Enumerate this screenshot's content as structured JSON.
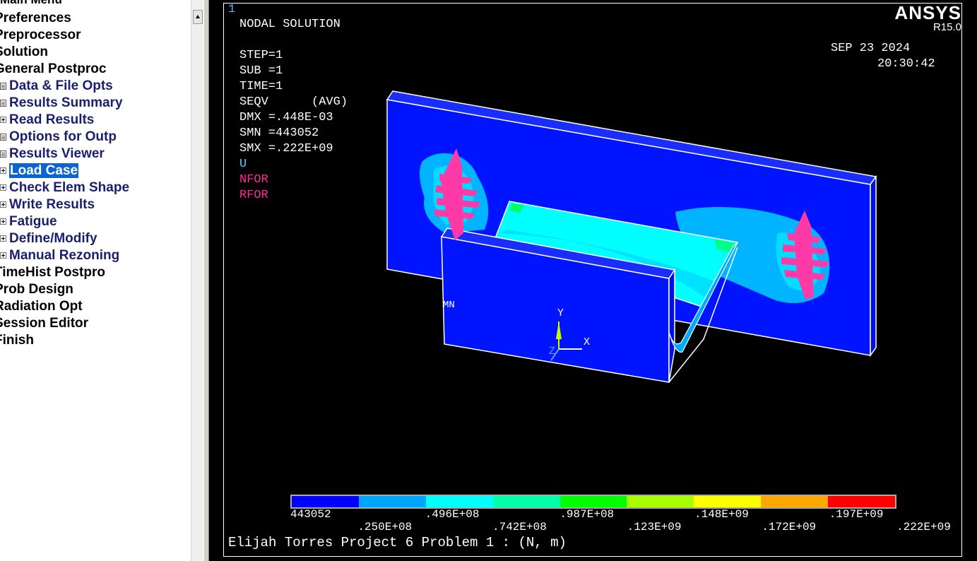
{
  "tree": {
    "title": "Main Menu",
    "items": [
      {
        "label": "Preferences",
        "level": 0
      },
      {
        "label": "Preprocessor",
        "level": 0
      },
      {
        "label": "Solution",
        "level": 0
      },
      {
        "label": "General Postproc",
        "level": 0
      },
      {
        "label": "Data & File Opts",
        "level": 1,
        "icon": "doc-icon"
      },
      {
        "label": "Results Summary",
        "level": 1,
        "icon": "doc-icon"
      },
      {
        "label": "Read Results",
        "level": 1,
        "icon": "expand-icon"
      },
      {
        "label": "Options for Outp",
        "level": 1,
        "icon": "doc-icon"
      },
      {
        "label": "Results Viewer",
        "level": 1,
        "icon": "doc-icon"
      },
      {
        "label": "Load Case",
        "level": 1,
        "icon": "expand-icon",
        "selected": true
      },
      {
        "label": "Check Elem Shape",
        "level": 1,
        "icon": "expand-icon"
      },
      {
        "label": "Write Results",
        "level": 1,
        "icon": "expand-icon"
      },
      {
        "label": "Fatigue",
        "level": 1,
        "icon": "expand-icon"
      },
      {
        "label": "Define/Modify",
        "level": 1,
        "icon": "expand-icon"
      },
      {
        "label": "Manual Rezoning",
        "level": 1,
        "icon": "expand-icon"
      },
      {
        "label": "TimeHist Postpro",
        "level": 0
      },
      {
        "label": "Prob Design",
        "level": 0
      },
      {
        "label": "Radiation Opt",
        "level": 0
      },
      {
        "label": "Session Editor",
        "level": 0
      },
      {
        "label": "Finish",
        "level": 0
      }
    ]
  },
  "graphics": {
    "window_number": "1",
    "brand": "ANSYS",
    "version": "R15.0",
    "info_lines": [
      "NODAL SOLUTION",
      "",
      "STEP=1",
      "SUB =1",
      "TIME=1",
      "SEQV      (AVG)",
      "DMX =.448E-03",
      "SMN =443052",
      "SMX =.222E+09"
    ],
    "date": "SEP 23 2024",
    "time": "20:30:42",
    "legend": {
      "u": "U",
      "nfor": "NFOR",
      "rfor": "RFOR"
    },
    "mn_label": "MN",
    "axis_labels": {
      "x": "X",
      "y": "Y",
      "z": "Z"
    },
    "contour_colors": [
      "#0000ff",
      "#00a6ff",
      "#00ffff",
      "#00ffa6",
      "#00ff00",
      "#a6ff00",
      "#ffff00",
      "#ffa600",
      "#ff0000"
    ],
    "contour_labels_top": [
      "443052",
      ".496E+08",
      ".987E+08",
      ".148E+09",
      ".197E+09"
    ],
    "contour_labels_bottom": [
      ".250E+08",
      ".742E+08",
      ".123E+09",
      ".172E+09",
      ".222E+09"
    ],
    "footer": "Elijah Torres Project 6 Problem 1 : (N, m)",
    "colors": {
      "background": "#000000",
      "model_blue": "#0014ff",
      "stress_light": "#00c8ff",
      "stress_cyan": "#00ffff",
      "force_magenta": "#ff3aa6"
    }
  }
}
